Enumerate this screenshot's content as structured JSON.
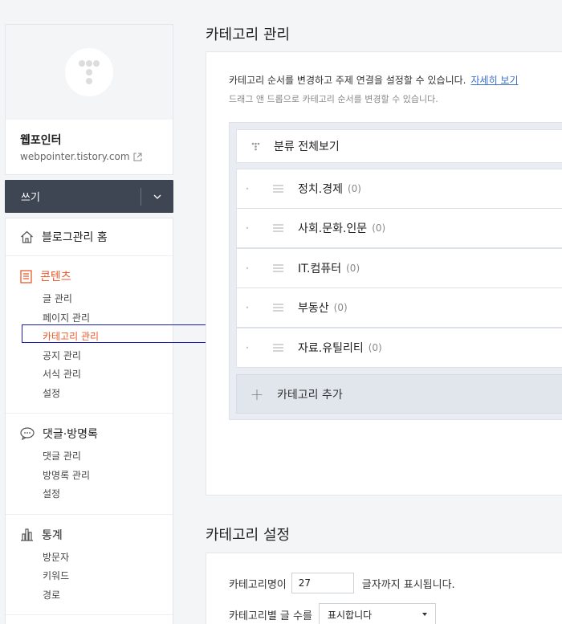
{
  "profile": {
    "name": "웹포인터",
    "url": "webpointer.tistory.com"
  },
  "write_button": {
    "label": "쓰기"
  },
  "menu": {
    "home": "블로그관리 홈",
    "sections": [
      {
        "title": "콘텐츠",
        "items": [
          "글 관리",
          "페이지 관리",
          "카테고리 관리",
          "공지 관리",
          "서식 관리",
          "설정"
        ]
      },
      {
        "title": "댓글·방명록",
        "items": [
          "댓글 관리",
          "방명록 관리",
          "설정"
        ]
      },
      {
        "title": "통계",
        "items": [
          "방문자",
          "키워드",
          "경로"
        ]
      }
    ]
  },
  "category_management": {
    "title": "카테고리 관리",
    "description": "카테고리 순서를 변경하고 주제 연결을 설정할 수 있습니다.",
    "more_link": "자세히 보기",
    "hint": "드래그 앤 드롭으로 카테고리 순서를 변경할 수 있습니다.",
    "all_label": "분류 전체보기",
    "categories": [
      {
        "name": "정치.경제",
        "count": "(0)"
      },
      {
        "name": "사회.문화.인문",
        "count": "(0)"
      },
      {
        "name": "IT.컴퓨터",
        "count": "(0)"
      },
      {
        "name": "부동산",
        "count": "(0)"
      },
      {
        "name": "자료.유틸리티",
        "count": "(0)"
      }
    ],
    "add_label": "카테고리 추가"
  },
  "category_settings": {
    "title": "카테고리 설정",
    "name_label": "카테고리명이",
    "name_value": "27",
    "name_suffix": "글자까지 표시됩니다.",
    "count_label": "카테고리별 글 수를",
    "count_value": "표시합니다"
  },
  "colors": {
    "accent": "#ee5a2c",
    "dark": "#3e4654",
    "link": "#3a6fc8"
  }
}
